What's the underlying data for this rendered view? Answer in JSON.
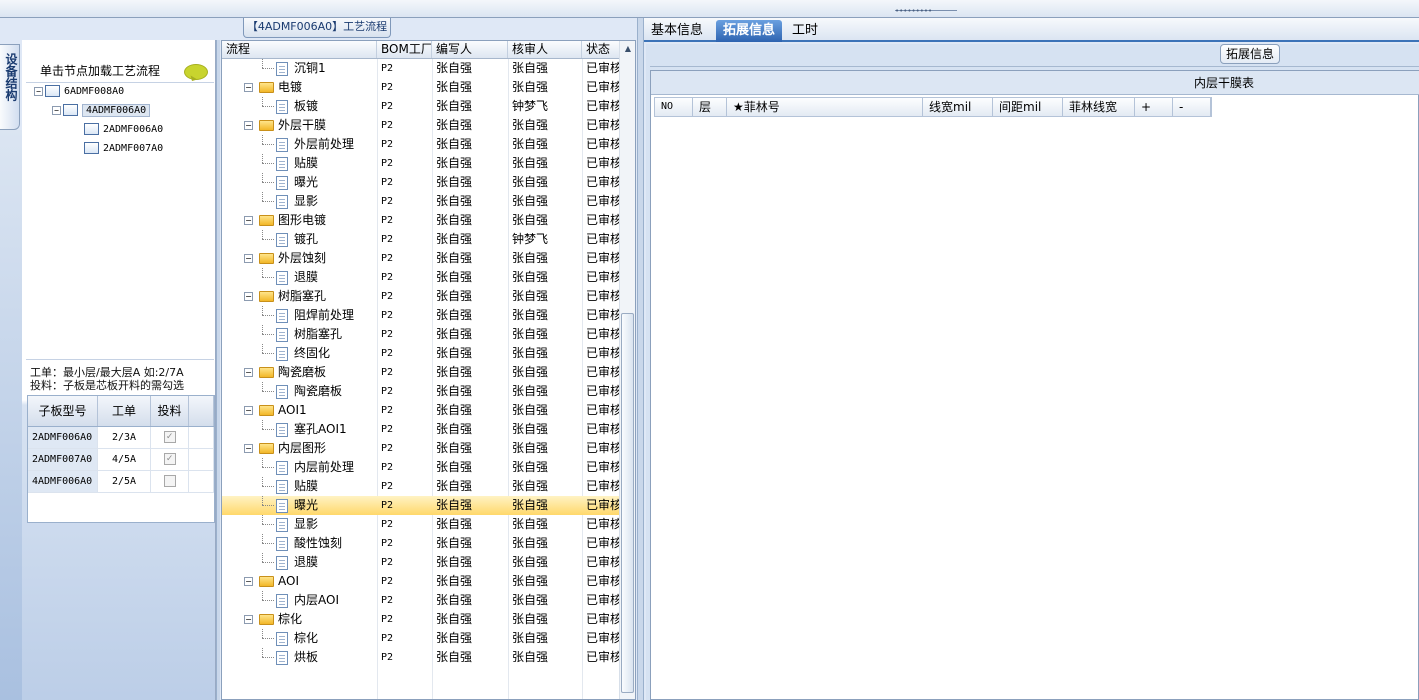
{
  "window": {
    "grip": "•••••••••"
  },
  "left_tab": {
    "label": "设备结构"
  },
  "tree_panel": {
    "hint": "单击节点加载工艺流程",
    "nodes": [
      {
        "label": "6ADMF008A0",
        "toggle": "−"
      },
      {
        "label": "4ADMF006A0",
        "toggle": "−"
      },
      {
        "label": "2ADMF006A0"
      },
      {
        "label": "2ADMF007A0"
      }
    ]
  },
  "note": {
    "line1": "工单：最小层/最大层A 如:2/7A",
    "line2": "投料：子板是芯板开料的需勾选"
  },
  "sub_board_grid": {
    "headers": [
      "子板型号",
      "工单",
      "投料"
    ],
    "rows": [
      {
        "model": "2ADMF006A0",
        "order": "2/3A",
        "feed": "✓"
      },
      {
        "model": "2ADMF007A0",
        "order": "4/5A",
        "feed": "✓"
      },
      {
        "model": "4ADMF006A0",
        "order": "2/5A",
        "feed": ""
      }
    ]
  },
  "process_title": "【4ADMF006A0】工艺流程",
  "process_grid": {
    "headers": [
      "流程",
      "BOM工厂",
      "编写人",
      "核审人",
      "状态"
    ],
    "rows": [
      {
        "flow": "沉铜1",
        "type": "doc",
        "bom": "P2",
        "writer": "张自强",
        "reviewer": "张自强",
        "status": "已审核"
      },
      {
        "flow": "电镀",
        "type": "folder",
        "bom": "P2",
        "writer": "张自强",
        "reviewer": "张自强",
        "status": "已审核"
      },
      {
        "flow": "板镀",
        "type": "doc",
        "bom": "P2",
        "writer": "张自强",
        "reviewer": "钟梦飞",
        "status": "已审核"
      },
      {
        "flow": "外层干膜",
        "type": "folder",
        "bom": "P2",
        "writer": "张自强",
        "reviewer": "张自强",
        "status": "已审核"
      },
      {
        "flow": "外层前处理",
        "type": "doc",
        "bom": "P2",
        "writer": "张自强",
        "reviewer": "张自强",
        "status": "已审核"
      },
      {
        "flow": "贴膜",
        "type": "doc",
        "bom": "P2",
        "writer": "张自强",
        "reviewer": "张自强",
        "status": "已审核"
      },
      {
        "flow": "曝光",
        "type": "doc",
        "bom": "P2",
        "writer": "张自强",
        "reviewer": "张自强",
        "status": "已审核"
      },
      {
        "flow": "显影",
        "type": "doc",
        "bom": "P2",
        "writer": "张自强",
        "reviewer": "张自强",
        "status": "已审核"
      },
      {
        "flow": "图形电镀",
        "type": "folder",
        "bom": "P2",
        "writer": "张自强",
        "reviewer": "张自强",
        "status": "已审核"
      },
      {
        "flow": "镀孔",
        "type": "doc",
        "bom": "P2",
        "writer": "张自强",
        "reviewer": "钟梦飞",
        "status": "已审核"
      },
      {
        "flow": "外层蚀刻",
        "type": "folder",
        "bom": "P2",
        "writer": "张自强",
        "reviewer": "张自强",
        "status": "已审核"
      },
      {
        "flow": "退膜",
        "type": "doc",
        "bom": "P2",
        "writer": "张自强",
        "reviewer": "张自强",
        "status": "已审核"
      },
      {
        "flow": "树脂塞孔",
        "type": "folder",
        "bom": "P2",
        "writer": "张自强",
        "reviewer": "张自强",
        "status": "已审核"
      },
      {
        "flow": "阻焊前处理",
        "type": "doc",
        "bom": "P2",
        "writer": "张自强",
        "reviewer": "张自强",
        "status": "已审核"
      },
      {
        "flow": "树脂塞孔",
        "type": "doc",
        "bom": "P2",
        "writer": "张自强",
        "reviewer": "张自强",
        "status": "已审核"
      },
      {
        "flow": "终固化",
        "type": "doc",
        "bom": "P2",
        "writer": "张自强",
        "reviewer": "张自强",
        "status": "已审核"
      },
      {
        "flow": "陶瓷磨板",
        "type": "folder",
        "bom": "P2",
        "writer": "张自强",
        "reviewer": "张自强",
        "status": "已审核"
      },
      {
        "flow": "陶瓷磨板",
        "type": "doc",
        "bom": "P2",
        "writer": "张自强",
        "reviewer": "张自强",
        "status": "已审核"
      },
      {
        "flow": "AOI1",
        "type": "folder",
        "bom": "P2",
        "writer": "张自强",
        "reviewer": "张自强",
        "status": "已审核"
      },
      {
        "flow": "塞孔AOI1",
        "type": "doc",
        "bom": "P2",
        "writer": "张自强",
        "reviewer": "张自强",
        "status": "已审核"
      },
      {
        "flow": "内层图形",
        "type": "folder",
        "bom": "P2",
        "writer": "张自强",
        "reviewer": "张自强",
        "status": "已审核"
      },
      {
        "flow": "内层前处理",
        "type": "doc",
        "bom": "P2",
        "writer": "张自强",
        "reviewer": "张自强",
        "status": "已审核"
      },
      {
        "flow": "贴膜",
        "type": "doc",
        "bom": "P2",
        "writer": "张自强",
        "reviewer": "张自强",
        "status": "已审核"
      },
      {
        "flow": "曝光",
        "type": "doc",
        "bom": "P2",
        "writer": "张自强",
        "reviewer": "张自强",
        "status": "已审核",
        "selected": true
      },
      {
        "flow": "显影",
        "type": "doc",
        "bom": "P2",
        "writer": "张自强",
        "reviewer": "张自强",
        "status": "已审核"
      },
      {
        "flow": "酸性蚀刻",
        "type": "doc",
        "bom": "P2",
        "writer": "张自强",
        "reviewer": "张自强",
        "status": "已审核"
      },
      {
        "flow": "退膜",
        "type": "doc",
        "bom": "P2",
        "writer": "张自强",
        "reviewer": "张自强",
        "status": "已审核"
      },
      {
        "flow": "AOI",
        "type": "folder",
        "bom": "P2",
        "writer": "张自强",
        "reviewer": "张自强",
        "status": "已审核"
      },
      {
        "flow": "内层AOI",
        "type": "doc",
        "bom": "P2",
        "writer": "张自强",
        "reviewer": "张自强",
        "status": "已审核"
      },
      {
        "flow": "棕化",
        "type": "folder",
        "bom": "P2",
        "writer": "张自强",
        "reviewer": "张自强",
        "status": "已审核"
      },
      {
        "flow": "棕化",
        "type": "doc",
        "bom": "P2",
        "writer": "张自强",
        "reviewer": "张自强",
        "status": "已审核"
      },
      {
        "flow": "烘板",
        "type": "doc",
        "bom": "P2",
        "writer": "张自强",
        "reviewer": "张自强",
        "status": "已审核"
      }
    ]
  },
  "right_tabs": [
    {
      "label": "基本信息",
      "active": false
    },
    {
      "label": "拓展信息",
      "active": true
    },
    {
      "label": "工时",
      "active": false
    }
  ],
  "ext_group_label": "拓展信息",
  "inner_table": {
    "title": "内层干膜表",
    "headers": [
      "NO",
      "层",
      "★菲林号",
      "线宽mil",
      "间距mil",
      "菲林线宽",
      "+",
      "-"
    ]
  },
  "colors": {
    "accent": "#3c73b8",
    "selection": "#ffd86b",
    "folder": "#f2b728"
  }
}
